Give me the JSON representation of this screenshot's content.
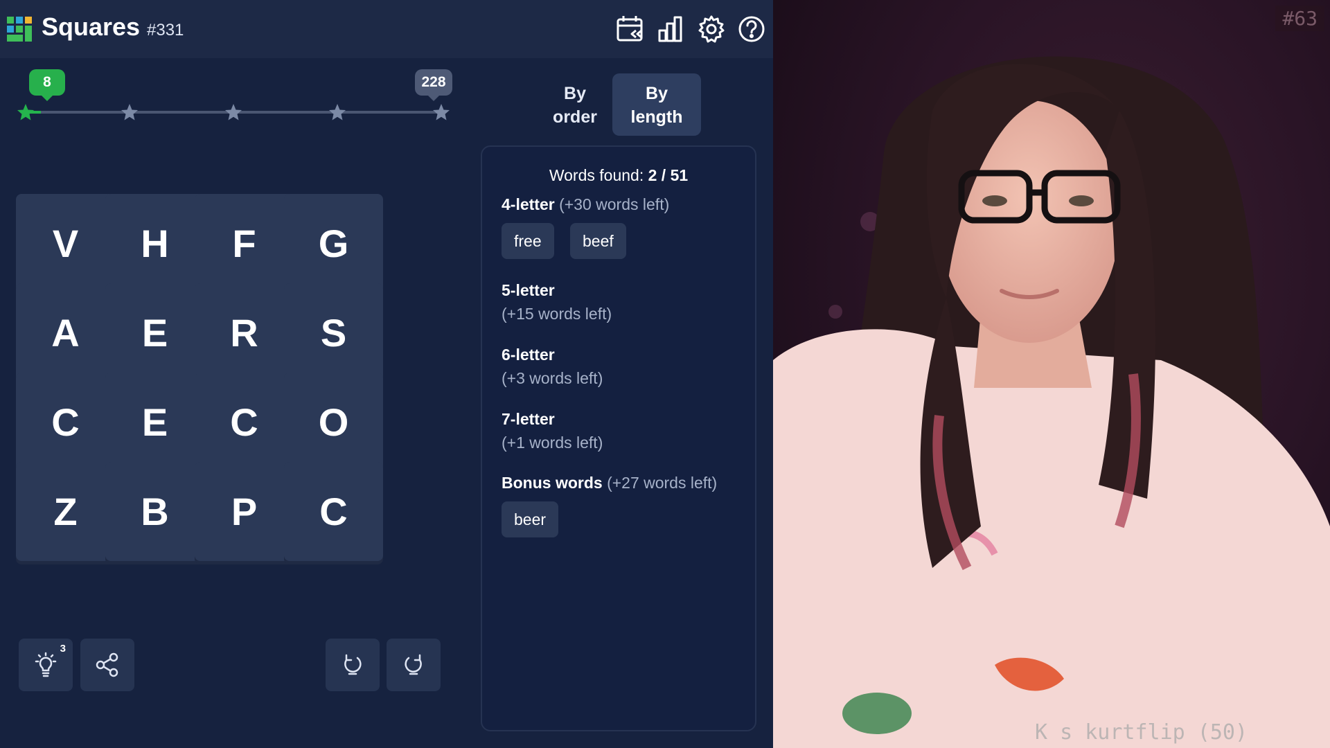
{
  "header": {
    "title": "Squares",
    "puzzle_number": "#331",
    "icons": [
      "calendar-archive-icon",
      "stats-icon",
      "settings-icon",
      "help-icon"
    ]
  },
  "progress": {
    "score": "8",
    "max_score": "228",
    "fraction": 0.035,
    "milestones": 5,
    "colors": {
      "achieved": "#25b44d",
      "pending": "#4a5672"
    }
  },
  "grid": {
    "rows": [
      [
        "V",
        "H",
        "F",
        "G"
      ],
      [
        "A",
        "E",
        "R",
        "S"
      ],
      [
        "C",
        "E",
        "C",
        "O"
      ],
      [
        "Z",
        "B",
        "P",
        "C"
      ]
    ]
  },
  "controls": {
    "hint_count": "3",
    "icons": [
      "lightbulb-icon",
      "share-icon",
      "rotate-left-icon",
      "rotate-right-icon"
    ]
  },
  "sort": {
    "by_order_line1": "By",
    "by_order_line2": "order",
    "by_length_line1": "By",
    "by_length_line2": "length",
    "selected": "By length"
  },
  "words": {
    "found_label": "Words found: ",
    "found_value": "2 / 51",
    "groups": [
      {
        "title": "4-letter",
        "left": "(+30 words left)",
        "words": [
          "free",
          "beef"
        ]
      },
      {
        "title": "5-letter",
        "left": "(+15 words left)",
        "words": []
      },
      {
        "title": "6-letter",
        "left": "(+3 words left)",
        "words": []
      },
      {
        "title": "7-letter",
        "left": "(+1 words left)",
        "words": []
      },
      {
        "title": "Bonus words",
        "left": "(+27 words left)",
        "words": [
          "beer"
        ]
      }
    ]
  },
  "webcam": {
    "counter": "#63",
    "caption": "K    s kurtflip (50)"
  },
  "theme": {
    "background": "#16223f",
    "tile": "#2b3957",
    "accent_green": "#27b04c"
  }
}
